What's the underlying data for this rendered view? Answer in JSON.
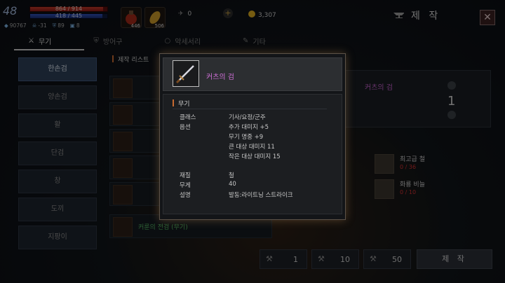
{
  "hud": {
    "level": "48",
    "hp": "864 / 914",
    "hp_fraction": 0.945,
    "mp": "418 / 445",
    "mp_fraction": 0.939,
    "stats": [
      "90767",
      "-31",
      "89",
      "8"
    ],
    "slot1_count": "446",
    "slot2_count": "506",
    "resource_count": "0",
    "plus": "+",
    "gold": "3,307"
  },
  "header": {
    "title": "제 작",
    "close": "✕"
  },
  "tabs": [
    {
      "label": "무기"
    },
    {
      "label": "방어구"
    },
    {
      "label": "악세서리"
    },
    {
      "label": "기타"
    }
  ],
  "sidebar": [
    {
      "label": "한손검"
    },
    {
      "label": "양손검"
    },
    {
      "label": "활"
    },
    {
      "label": "단검"
    },
    {
      "label": "창"
    },
    {
      "label": "도끼"
    },
    {
      "label": "지팡이"
    }
  ],
  "craft_list": {
    "header": "제작 리스트",
    "last_item": "커룬의 전검 (무기)"
  },
  "detail": {
    "name": "커츠의 검",
    "quantity": "1"
  },
  "materials": [
    {
      "name": "최고급 철",
      "count": "0 / 36"
    },
    {
      "name": "화룡 비늘",
      "count": "0 / 10"
    }
  ],
  "bottom": {
    "q1": "1",
    "q2": "10",
    "q3": "50",
    "craft": "제 작"
  },
  "tooltip": {
    "name": "커츠의 검",
    "category": "무기",
    "class_label": "클래스",
    "class_value": "기사/요정/군주",
    "option_label": "옵션",
    "options": [
      "추가 대미지 +5",
      "무기 명중 +9",
      "큰 대상 대미지 11",
      "작은 대상 대미지 15"
    ],
    "material_label": "재질",
    "material_value": "철",
    "weight_label": "무게",
    "weight_value": "40",
    "desc_label": "설명",
    "desc_value": "발동:라이트닝 스트라이크"
  }
}
